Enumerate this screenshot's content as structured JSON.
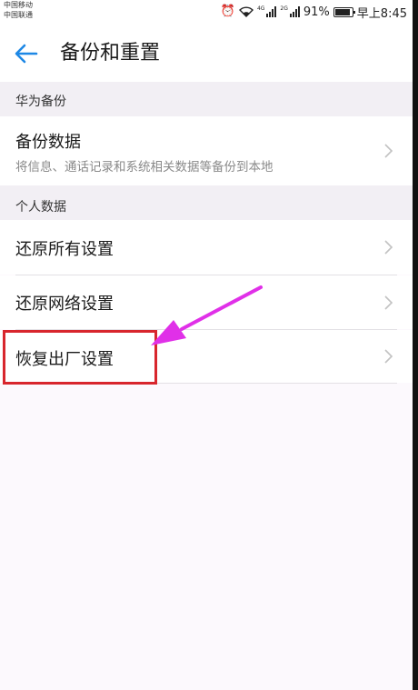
{
  "status_bar": {
    "carrier_1": "中国移动",
    "carrier_2": "中国联通",
    "alarm_icon": "alarm-clock-icon",
    "wifi_icon": "wifi-icon",
    "signal_1_tag": "4G",
    "signal_2_tag": "2G",
    "battery_percent": "91%",
    "time": "早上8:45"
  },
  "header": {
    "back_icon": "back-arrow-icon",
    "title": "备份和重置"
  },
  "sections": [
    {
      "title": "华为备份",
      "items": [
        {
          "label": "备份数据",
          "subtitle": "将信息、通话记录和系统相关数据等备份到本地"
        }
      ]
    },
    {
      "title": "个人数据",
      "items": [
        {
          "label": "还原所有设置"
        },
        {
          "label": "还原网络设置"
        },
        {
          "label": "恢复出厂设置"
        }
      ]
    }
  ],
  "annotation": {
    "box_color": "#d8262d",
    "arrow_color": "#e030e8"
  },
  "colors": {
    "accent": "#1e88e5",
    "chevron": "#c2c2c2"
  }
}
